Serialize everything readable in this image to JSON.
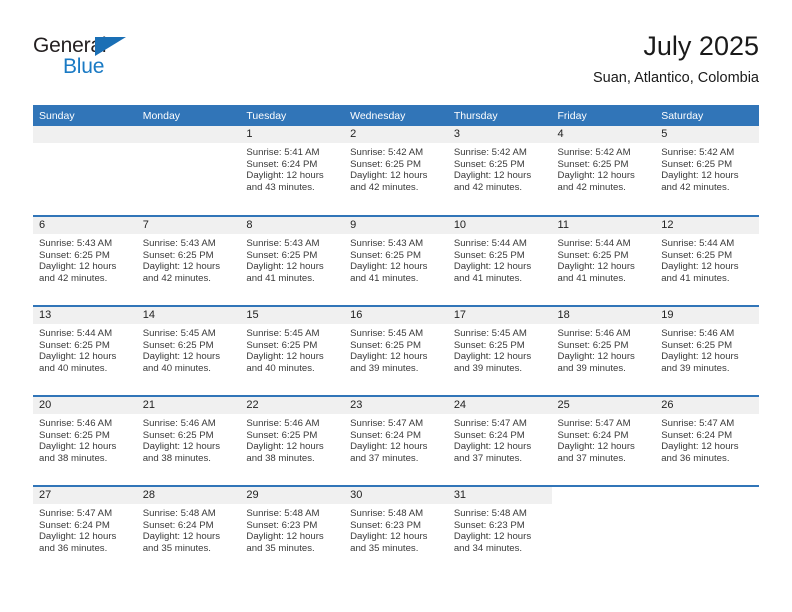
{
  "brand": {
    "name_top": "General",
    "name_bottom": "Blue",
    "accent_color": "#1a7ac4",
    "triangle_color": "#1a6fb5"
  },
  "header": {
    "title": "July 2025",
    "subtitle": "Suan, Atlantico, Colombia"
  },
  "calendar": {
    "header_color": "#3175b8",
    "daynum_band_color": "#f0f0f0",
    "weekdays": [
      "Sunday",
      "Monday",
      "Tuesday",
      "Wednesday",
      "Thursday",
      "Friday",
      "Saturday"
    ],
    "weeks": [
      [
        {
          "day": "",
          "sunrise": "",
          "sunset": "",
          "daylight_line1": "",
          "daylight_line2": "",
          "empty": true
        },
        {
          "day": "",
          "sunrise": "",
          "sunset": "",
          "daylight_line1": "",
          "daylight_line2": "",
          "empty": true
        },
        {
          "day": "1",
          "sunrise": "Sunrise: 5:41 AM",
          "sunset": "Sunset: 6:24 PM",
          "daylight_line1": "Daylight: 12 hours",
          "daylight_line2": "and 43 minutes."
        },
        {
          "day": "2",
          "sunrise": "Sunrise: 5:42 AM",
          "sunset": "Sunset: 6:25 PM",
          "daylight_line1": "Daylight: 12 hours",
          "daylight_line2": "and 42 minutes."
        },
        {
          "day": "3",
          "sunrise": "Sunrise: 5:42 AM",
          "sunset": "Sunset: 6:25 PM",
          "daylight_line1": "Daylight: 12 hours",
          "daylight_line2": "and 42 minutes."
        },
        {
          "day": "4",
          "sunrise": "Sunrise: 5:42 AM",
          "sunset": "Sunset: 6:25 PM",
          "daylight_line1": "Daylight: 12 hours",
          "daylight_line2": "and 42 minutes."
        },
        {
          "day": "5",
          "sunrise": "Sunrise: 5:42 AM",
          "sunset": "Sunset: 6:25 PM",
          "daylight_line1": "Daylight: 12 hours",
          "daylight_line2": "and 42 minutes."
        }
      ],
      [
        {
          "day": "6",
          "sunrise": "Sunrise: 5:43 AM",
          "sunset": "Sunset: 6:25 PM",
          "daylight_line1": "Daylight: 12 hours",
          "daylight_line2": "and 42 minutes."
        },
        {
          "day": "7",
          "sunrise": "Sunrise: 5:43 AM",
          "sunset": "Sunset: 6:25 PM",
          "daylight_line1": "Daylight: 12 hours",
          "daylight_line2": "and 42 minutes."
        },
        {
          "day": "8",
          "sunrise": "Sunrise: 5:43 AM",
          "sunset": "Sunset: 6:25 PM",
          "daylight_line1": "Daylight: 12 hours",
          "daylight_line2": "and 41 minutes."
        },
        {
          "day": "9",
          "sunrise": "Sunrise: 5:43 AM",
          "sunset": "Sunset: 6:25 PM",
          "daylight_line1": "Daylight: 12 hours",
          "daylight_line2": "and 41 minutes."
        },
        {
          "day": "10",
          "sunrise": "Sunrise: 5:44 AM",
          "sunset": "Sunset: 6:25 PM",
          "daylight_line1": "Daylight: 12 hours",
          "daylight_line2": "and 41 minutes."
        },
        {
          "day": "11",
          "sunrise": "Sunrise: 5:44 AM",
          "sunset": "Sunset: 6:25 PM",
          "daylight_line1": "Daylight: 12 hours",
          "daylight_line2": "and 41 minutes."
        },
        {
          "day": "12",
          "sunrise": "Sunrise: 5:44 AM",
          "sunset": "Sunset: 6:25 PM",
          "daylight_line1": "Daylight: 12 hours",
          "daylight_line2": "and 41 minutes."
        }
      ],
      [
        {
          "day": "13",
          "sunrise": "Sunrise: 5:44 AM",
          "sunset": "Sunset: 6:25 PM",
          "daylight_line1": "Daylight: 12 hours",
          "daylight_line2": "and 40 minutes."
        },
        {
          "day": "14",
          "sunrise": "Sunrise: 5:45 AM",
          "sunset": "Sunset: 6:25 PM",
          "daylight_line1": "Daylight: 12 hours",
          "daylight_line2": "and 40 minutes."
        },
        {
          "day": "15",
          "sunrise": "Sunrise: 5:45 AM",
          "sunset": "Sunset: 6:25 PM",
          "daylight_line1": "Daylight: 12 hours",
          "daylight_line2": "and 40 minutes."
        },
        {
          "day": "16",
          "sunrise": "Sunrise: 5:45 AM",
          "sunset": "Sunset: 6:25 PM",
          "daylight_line1": "Daylight: 12 hours",
          "daylight_line2": "and 39 minutes."
        },
        {
          "day": "17",
          "sunrise": "Sunrise: 5:45 AM",
          "sunset": "Sunset: 6:25 PM",
          "daylight_line1": "Daylight: 12 hours",
          "daylight_line2": "and 39 minutes."
        },
        {
          "day": "18",
          "sunrise": "Sunrise: 5:46 AM",
          "sunset": "Sunset: 6:25 PM",
          "daylight_line1": "Daylight: 12 hours",
          "daylight_line2": "and 39 minutes."
        },
        {
          "day": "19",
          "sunrise": "Sunrise: 5:46 AM",
          "sunset": "Sunset: 6:25 PM",
          "daylight_line1": "Daylight: 12 hours",
          "daylight_line2": "and 39 minutes."
        }
      ],
      [
        {
          "day": "20",
          "sunrise": "Sunrise: 5:46 AM",
          "sunset": "Sunset: 6:25 PM",
          "daylight_line1": "Daylight: 12 hours",
          "daylight_line2": "and 38 minutes."
        },
        {
          "day": "21",
          "sunrise": "Sunrise: 5:46 AM",
          "sunset": "Sunset: 6:25 PM",
          "daylight_line1": "Daylight: 12 hours",
          "daylight_line2": "and 38 minutes."
        },
        {
          "day": "22",
          "sunrise": "Sunrise: 5:46 AM",
          "sunset": "Sunset: 6:25 PM",
          "daylight_line1": "Daylight: 12 hours",
          "daylight_line2": "and 38 minutes."
        },
        {
          "day": "23",
          "sunrise": "Sunrise: 5:47 AM",
          "sunset": "Sunset: 6:24 PM",
          "daylight_line1": "Daylight: 12 hours",
          "daylight_line2": "and 37 minutes."
        },
        {
          "day": "24",
          "sunrise": "Sunrise: 5:47 AM",
          "sunset": "Sunset: 6:24 PM",
          "daylight_line1": "Daylight: 12 hours",
          "daylight_line2": "and 37 minutes."
        },
        {
          "day": "25",
          "sunrise": "Sunrise: 5:47 AM",
          "sunset": "Sunset: 6:24 PM",
          "daylight_line1": "Daylight: 12 hours",
          "daylight_line2": "and 37 minutes."
        },
        {
          "day": "26",
          "sunrise": "Sunrise: 5:47 AM",
          "sunset": "Sunset: 6:24 PM",
          "daylight_line1": "Daylight: 12 hours",
          "daylight_line2": "and 36 minutes."
        }
      ],
      [
        {
          "day": "27",
          "sunrise": "Sunrise: 5:47 AM",
          "sunset": "Sunset: 6:24 PM",
          "daylight_line1": "Daylight: 12 hours",
          "daylight_line2": "and 36 minutes."
        },
        {
          "day": "28",
          "sunrise": "Sunrise: 5:48 AM",
          "sunset": "Sunset: 6:24 PM",
          "daylight_line1": "Daylight: 12 hours",
          "daylight_line2": "and 35 minutes."
        },
        {
          "day": "29",
          "sunrise": "Sunrise: 5:48 AM",
          "sunset": "Sunset: 6:23 PM",
          "daylight_line1": "Daylight: 12 hours",
          "daylight_line2": "and 35 minutes."
        },
        {
          "day": "30",
          "sunrise": "Sunrise: 5:48 AM",
          "sunset": "Sunset: 6:23 PM",
          "daylight_line1": "Daylight: 12 hours",
          "daylight_line2": "and 35 minutes."
        },
        {
          "day": "31",
          "sunrise": "Sunrise: 5:48 AM",
          "sunset": "Sunset: 6:23 PM",
          "daylight_line1": "Daylight: 12 hours",
          "daylight_line2": "and 34 minutes."
        },
        {
          "day": "",
          "sunrise": "",
          "sunset": "",
          "daylight_line1": "",
          "daylight_line2": "",
          "blank": true
        },
        {
          "day": "",
          "sunrise": "",
          "sunset": "",
          "daylight_line1": "",
          "daylight_line2": "",
          "blank": true
        }
      ]
    ]
  }
}
